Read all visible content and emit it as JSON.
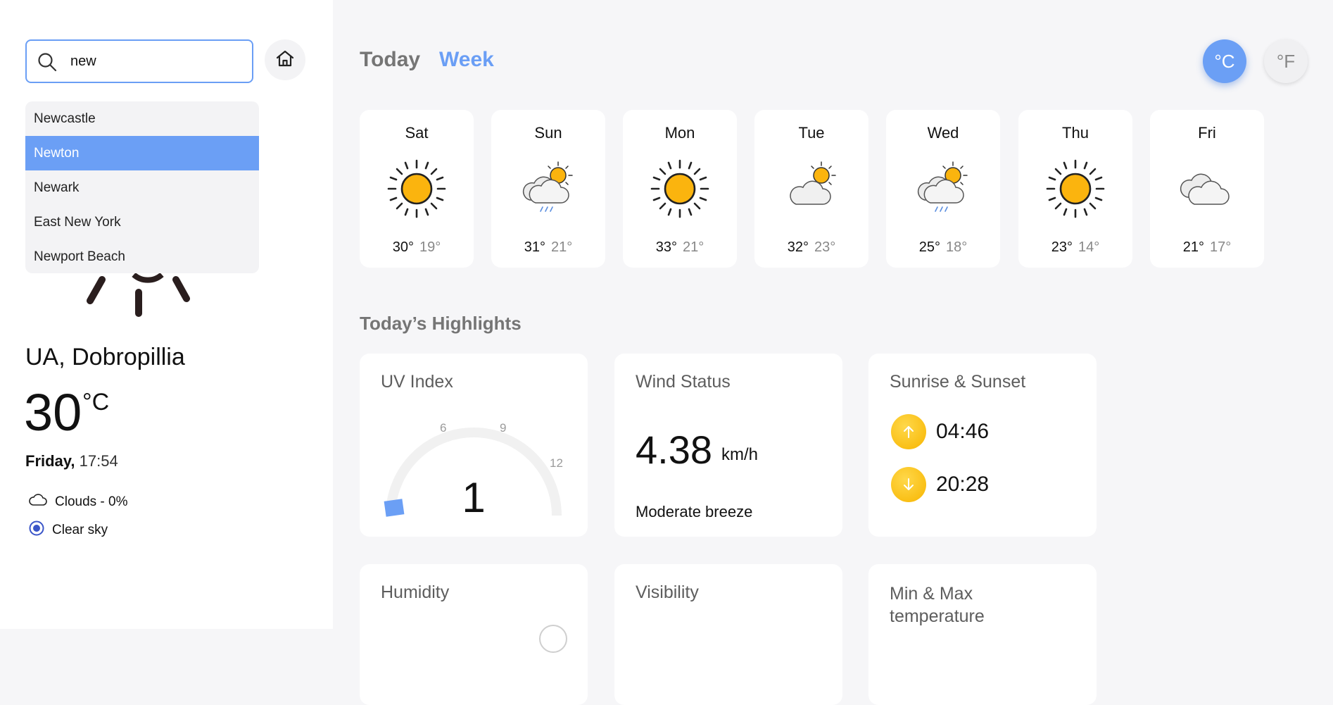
{
  "search": {
    "value": "new",
    "placeholder": ""
  },
  "dropdown": {
    "options": [
      "Newcastle",
      "Newton",
      "Newark",
      "East New York",
      "Newport Beach"
    ],
    "selected": "Newton"
  },
  "current": {
    "location": "UA, Dobropillia",
    "temp": "30",
    "unit": "°C",
    "day": "Friday,",
    "time": "17:54",
    "clouds": "Clouds - 0%",
    "description": "Clear sky"
  },
  "tabs": {
    "today": "Today",
    "week": "Week",
    "active": "Week"
  },
  "units": {
    "celsius": "°C",
    "fahrenheit": "°F",
    "active": "celsius"
  },
  "forecast": [
    {
      "day": "Sat",
      "icon": "sun-icon",
      "hi": "30°",
      "lo": "19°"
    },
    {
      "day": "Sun",
      "icon": "rain-cloud-sun-icon",
      "hi": "31°",
      "lo": "21°"
    },
    {
      "day": "Mon",
      "icon": "sun-icon",
      "hi": "33°",
      "lo": "21°"
    },
    {
      "day": "Tue",
      "icon": "cloud-sun-icon",
      "hi": "32°",
      "lo": "23°"
    },
    {
      "day": "Wed",
      "icon": "rain-cloud-sun-icon",
      "hi": "25°",
      "lo": "18°"
    },
    {
      "day": "Thu",
      "icon": "sun-icon",
      "hi": "23°",
      "lo": "14°"
    },
    {
      "day": "Fri",
      "icon": "clouds-icon",
      "hi": "21°",
      "lo": "17°"
    }
  ],
  "highlights": {
    "title": "Today’s Highlights",
    "uv": {
      "title": "UV Index",
      "value": "1",
      "ticks": [
        "6",
        "9",
        "12"
      ]
    },
    "wind": {
      "title": "Wind Status",
      "value": "4.38",
      "unit": "km/h",
      "description": "Moderate breeze"
    },
    "sun": {
      "title": "Sunrise & Sunset",
      "sunrise": "04:46",
      "sunset": "20:28"
    },
    "humidity": {
      "title": "Humidity"
    },
    "visibility": {
      "title": "Visibility"
    },
    "minmax": {
      "title": "Min & Max temperature"
    }
  },
  "colors": {
    "accent": "#6b9ff5",
    "sun": "#fbb40e",
    "panel": "#ffffff",
    "background": "#f6f6f8"
  }
}
